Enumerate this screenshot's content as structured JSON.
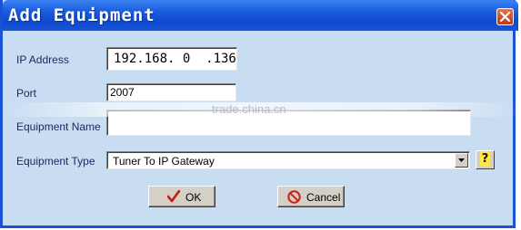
{
  "window": {
    "title": "Add Equipment",
    "close_icon": "close-x-icon"
  },
  "form": {
    "ip_address": {
      "label": "IP Address",
      "value": "192.168. 0  .136"
    },
    "port": {
      "label": "Port",
      "value": "2007"
    },
    "equipment_name": {
      "label": "Equipment Name",
      "value": ""
    },
    "equipment_type": {
      "label": "Equipment Type",
      "value": "Tuner To IP Gateway",
      "dropdown_icon": "chevron-down-icon"
    },
    "help": {
      "label": "?",
      "icon": "help-icon"
    }
  },
  "buttons": {
    "ok": {
      "label": "OK",
      "icon": "checkmark-icon",
      "icon_color": "#c02010"
    },
    "cancel": {
      "label": "Cancel",
      "icon": "no-entry-icon",
      "icon_color": "#d02010"
    }
  },
  "watermark": {
    "text": "trade.china.cn"
  },
  "colors": {
    "title_bar": "#0e49cf",
    "client_area": "#c8dcf2",
    "label_text": "#202860"
  }
}
